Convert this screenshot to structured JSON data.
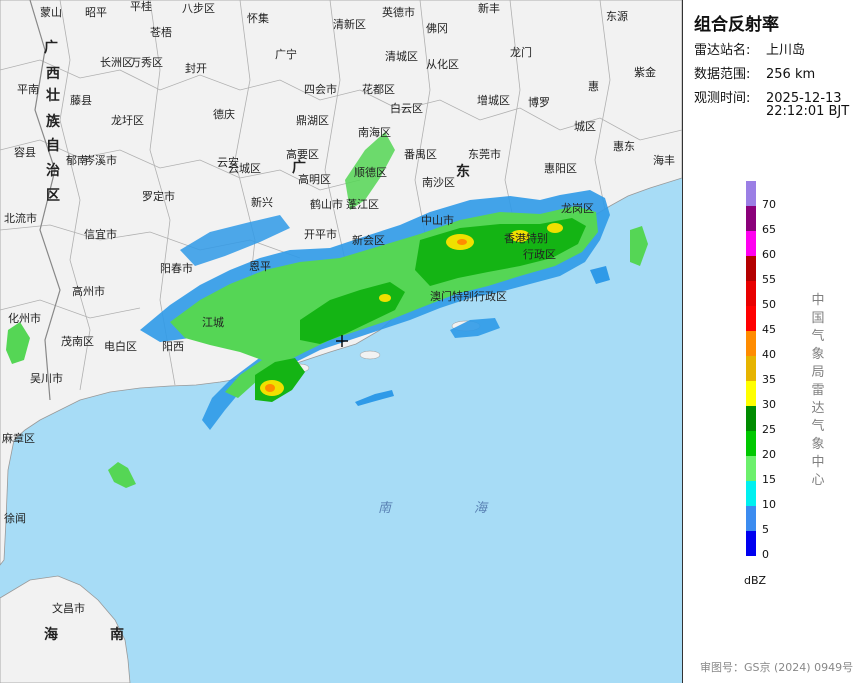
{
  "panel": {
    "title": "组合反射率",
    "station_key": "雷达站名:",
    "station_value": "上川岛",
    "range_key": "数据范围:",
    "range_value": "256 km",
    "time_key": "观测时间:",
    "time_date": "2025-12-13",
    "time_clock": "22:12:01 BJT",
    "vertical_text": [
      "中",
      "国",
      "气",
      "象",
      "局",
      "雷",
      "达",
      "气",
      "象",
      "中",
      "心"
    ],
    "unit": "dBZ",
    "footer": "审图号：GS京 (2024) 0949号"
  },
  "legend": {
    "colors": [
      "#9b7fe5",
      "#8a007a",
      "#ff00f0",
      "#b40000",
      "#e80000",
      "#ff0000",
      "#ff8c00",
      "#e6b400",
      "#ffff00",
      "#008c00",
      "#00c800",
      "#6cf06c",
      "#00f0f0",
      "#3c8cf0",
      "#0000f0"
    ],
    "labels": [
      "70",
      "65",
      "60",
      "55",
      "50",
      "45",
      "40",
      "35",
      "30",
      "25",
      "20",
      "15",
      "10",
      "5",
      "0"
    ]
  },
  "map": {
    "colors": {
      "land": "#f2f2f2",
      "sea": "#a7dcf6",
      "border": "#b0b0b0"
    },
    "places": [
      {
        "t": "蒙山"
      },
      {
        "t": "昭平"
      },
      {
        "t": "平桂"
      },
      {
        "t": "八步区"
      },
      {
        "t": "怀集"
      },
      {
        "t": "清新区"
      },
      {
        "t": "英德市"
      },
      {
        "t": "新丰"
      },
      {
        "t": "东源"
      },
      {
        "t": "苍梧"
      },
      {
        "t": "长洲区"
      },
      {
        "t": "万秀区"
      },
      {
        "t": "封开"
      },
      {
        "t": "广宁"
      },
      {
        "t": "清城区"
      },
      {
        "t": "佛冈"
      },
      {
        "t": "从化区"
      },
      {
        "t": "龙门"
      },
      {
        "t": "紫金"
      },
      {
        "t": "平南"
      },
      {
        "t": "藤县"
      },
      {
        "t": "四会市"
      },
      {
        "t": "花都区"
      },
      {
        "t": "增城区"
      },
      {
        "t": "博罗"
      },
      {
        "t": "惠"
      },
      {
        "t": "城区"
      },
      {
        "t": "龙圩区"
      },
      {
        "t": "德庆"
      },
      {
        "t": "鼎湖区"
      },
      {
        "t": "白云区"
      },
      {
        "t": "容县"
      },
      {
        "t": "郁南"
      },
      {
        "t": "云安"
      },
      {
        "t": "高要区"
      },
      {
        "t": "南海区"
      },
      {
        "t": "番禺区"
      },
      {
        "t": "东莞市"
      },
      {
        "t": "惠东"
      },
      {
        "t": "海丰"
      },
      {
        "t": "岑溪市"
      },
      {
        "t": "云城区"
      },
      {
        "t": "高明区"
      },
      {
        "t": "顺德区"
      },
      {
        "t": "南沙区"
      },
      {
        "t": "惠阳区"
      },
      {
        "t": "罗定市"
      },
      {
        "t": "新兴"
      },
      {
        "t": "鹤山市"
      },
      {
        "t": "蓬江区"
      },
      {
        "t": "中山市"
      },
      {
        "t": "龙岗区"
      },
      {
        "t": "北流市"
      },
      {
        "t": "信宜市"
      },
      {
        "t": "开平市"
      },
      {
        "t": "新会区"
      },
      {
        "t": "香港特别"
      },
      {
        "t": "行政区"
      },
      {
        "t": "阳春市"
      },
      {
        "t": "恩平"
      },
      {
        "t": "澳门特别行政区"
      },
      {
        "t": "高州市"
      },
      {
        "t": "化州市"
      },
      {
        "t": "江城"
      },
      {
        "t": "茂南区"
      },
      {
        "t": "电白区"
      },
      {
        "t": "阳西"
      },
      {
        "t": "吴川市"
      },
      {
        "t": "麻章区"
      },
      {
        "t": "徐闻"
      },
      {
        "t": "文昌市"
      }
    ],
    "big_labels": [
      {
        "t": "广"
      },
      {
        "t": "西"
      },
      {
        "t": "壮"
      },
      {
        "t": "族"
      },
      {
        "t": "自"
      },
      {
        "t": "治"
      },
      {
        "t": "区"
      },
      {
        "t": "广"
      },
      {
        "t": "东"
      },
      {
        "t": "海"
      },
      {
        "t": "南"
      }
    ],
    "sea_labels": [
      {
        "t": "南"
      },
      {
        "t": "海"
      }
    ]
  }
}
